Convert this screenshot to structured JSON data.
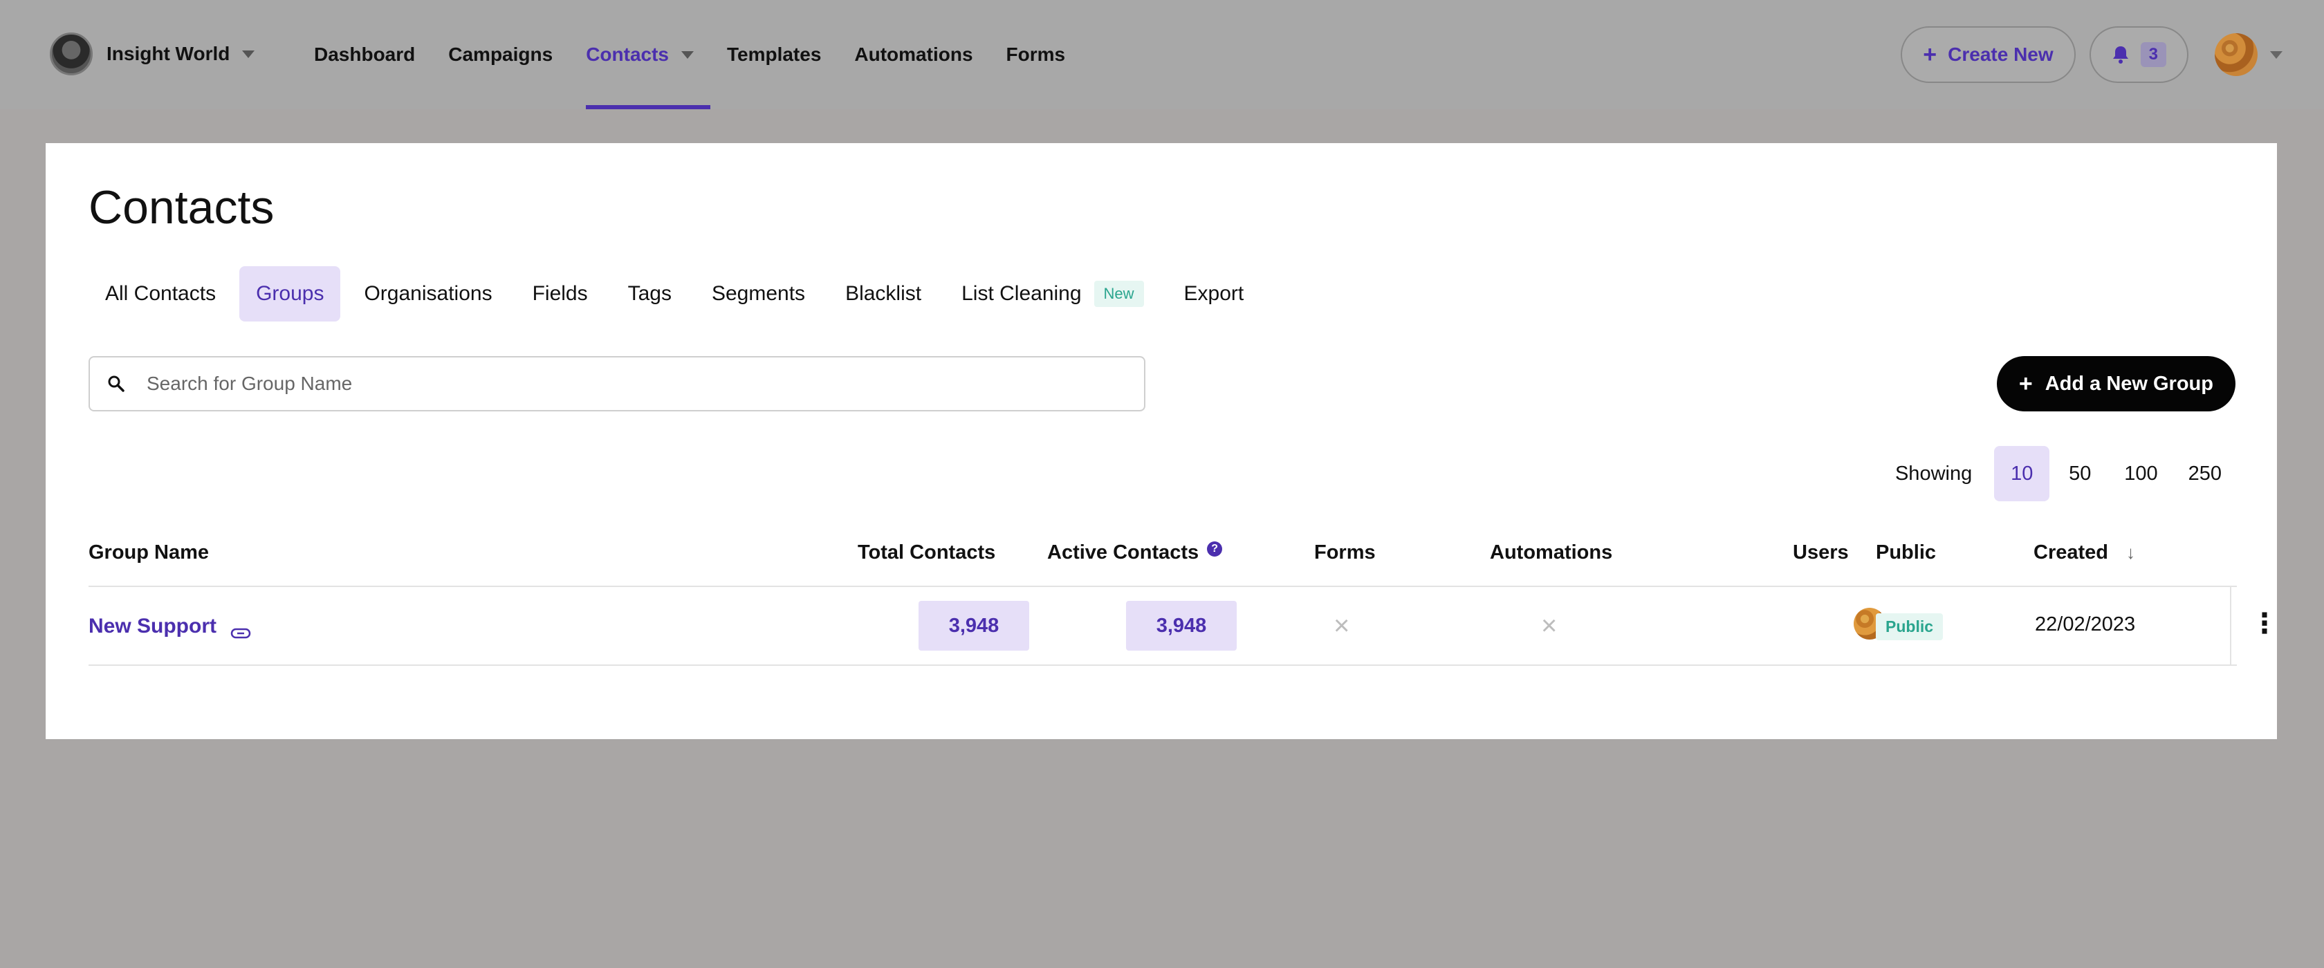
{
  "header": {
    "workspace_name": "Insight World",
    "nav": [
      "Dashboard",
      "Campaigns",
      "Contacts",
      "Templates",
      "Automations",
      "Forms"
    ],
    "active_nav": "Contacts",
    "create_new_label": "Create New",
    "notification_count": "3"
  },
  "page": {
    "title": "Contacts",
    "tabs": [
      "All Contacts",
      "Groups",
      "Organisations",
      "Fields",
      "Tags",
      "Segments",
      "Blacklist",
      "List Cleaning",
      "Export"
    ],
    "active_tab": "Groups",
    "new_badge": "New",
    "search_placeholder": "Search for Group Name",
    "add_group_label": "Add a New Group",
    "showing_label": "Showing",
    "page_sizes": [
      "10",
      "50",
      "100",
      "250"
    ],
    "active_page_size": "10"
  },
  "table": {
    "columns": {
      "group_name": "Group Name",
      "total_contacts": "Total Contacts",
      "active_contacts": "Active Contacts",
      "forms": "Forms",
      "automations": "Automations",
      "users": "Users",
      "public": "Public",
      "created": "Created"
    },
    "rows": [
      {
        "group_name": "New Support",
        "total_contacts": "3,948",
        "active_contacts": "3,948",
        "forms": "×",
        "automations": "×",
        "public": "Public",
        "created": "22/02/2023"
      }
    ]
  },
  "colors": {
    "accent": "#4b2fae",
    "accent_bg": "#e6dff8",
    "badge_green": "#2aa58e",
    "overlay_bg": "#a9a6a5"
  },
  "icons": [
    "brand-avatar",
    "chevron-down-icon",
    "plus-icon",
    "bell-icon",
    "user-avatar",
    "search-icon",
    "help-icon",
    "sort-down-icon",
    "link-icon",
    "close-icon",
    "kebab-icon"
  ]
}
